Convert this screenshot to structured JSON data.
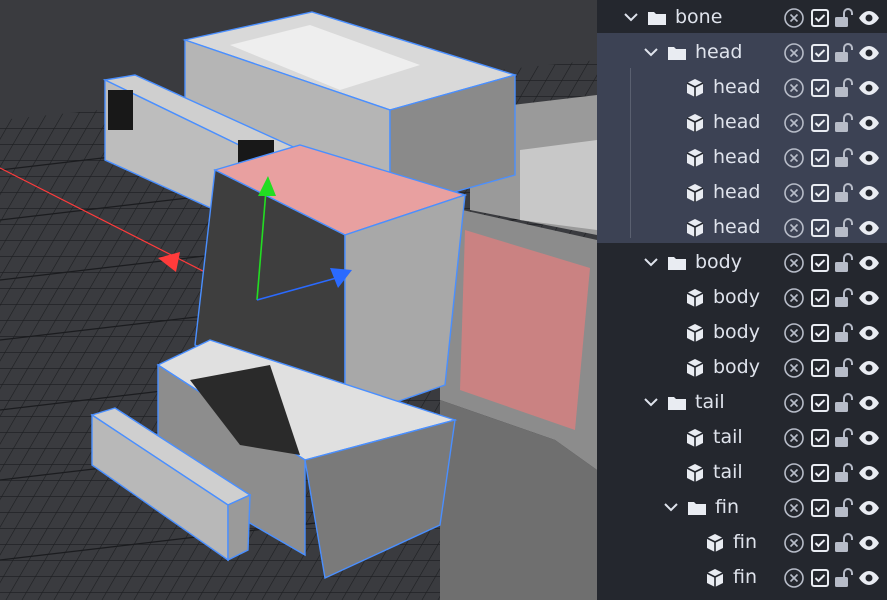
{
  "outliner": {
    "rows": [
      {
        "type": "group",
        "label": "bone",
        "depth": 0
      },
      {
        "type": "group",
        "label": "head",
        "depth": 1
      },
      {
        "type": "cube",
        "label": "head",
        "depth": 2
      },
      {
        "type": "cube",
        "label": "head",
        "depth": 2
      },
      {
        "type": "cube",
        "label": "head",
        "depth": 2
      },
      {
        "type": "cube",
        "label": "head",
        "depth": 2
      },
      {
        "type": "cube",
        "label": "head",
        "depth": 2
      },
      {
        "type": "group",
        "label": "body",
        "depth": 1
      },
      {
        "type": "cube",
        "label": "body",
        "depth": 2
      },
      {
        "type": "cube",
        "label": "body",
        "depth": 2
      },
      {
        "type": "cube",
        "label": "body",
        "depth": 2
      },
      {
        "type": "group",
        "label": "tail",
        "depth": 1
      },
      {
        "type": "cube",
        "label": "tail",
        "depth": 2
      },
      {
        "type": "cube",
        "label": "tail",
        "depth": 2
      },
      {
        "type": "group",
        "label": "fin",
        "depth": 2
      },
      {
        "type": "cube",
        "label": "fin",
        "depth": 3
      },
      {
        "type": "cube",
        "label": "fin",
        "depth": 3
      }
    ]
  },
  "icons": {
    "group": "folder-icon",
    "cube": "cube-icon",
    "expand": "chevron-down-icon",
    "delete": "remove-circle-icon",
    "visibility": "checkbox-checked-icon",
    "lock": "lock-open-icon",
    "eye": "eye-icon"
  },
  "colors": {
    "viewport_bg": "#3a3b3f",
    "outliner_bg": "#24272e",
    "selected_bg": "#3c4254",
    "selection_outline": "#4a8fff",
    "axis_x": "#ff3b3b",
    "axis_y": "#22dd22",
    "axis_z": "#2a6aff"
  }
}
